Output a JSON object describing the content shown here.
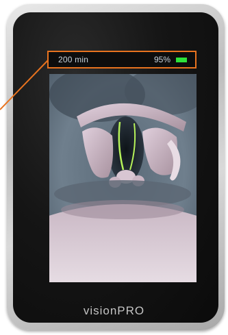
{
  "status_bar": {
    "runtime": "200 min",
    "battery_percent": "95%",
    "battery_icon": "battery-full-icon",
    "battery_color": "#2ee23a",
    "highlight_color": "#e8731f"
  },
  "brand": {
    "name": "visionPRO"
  }
}
